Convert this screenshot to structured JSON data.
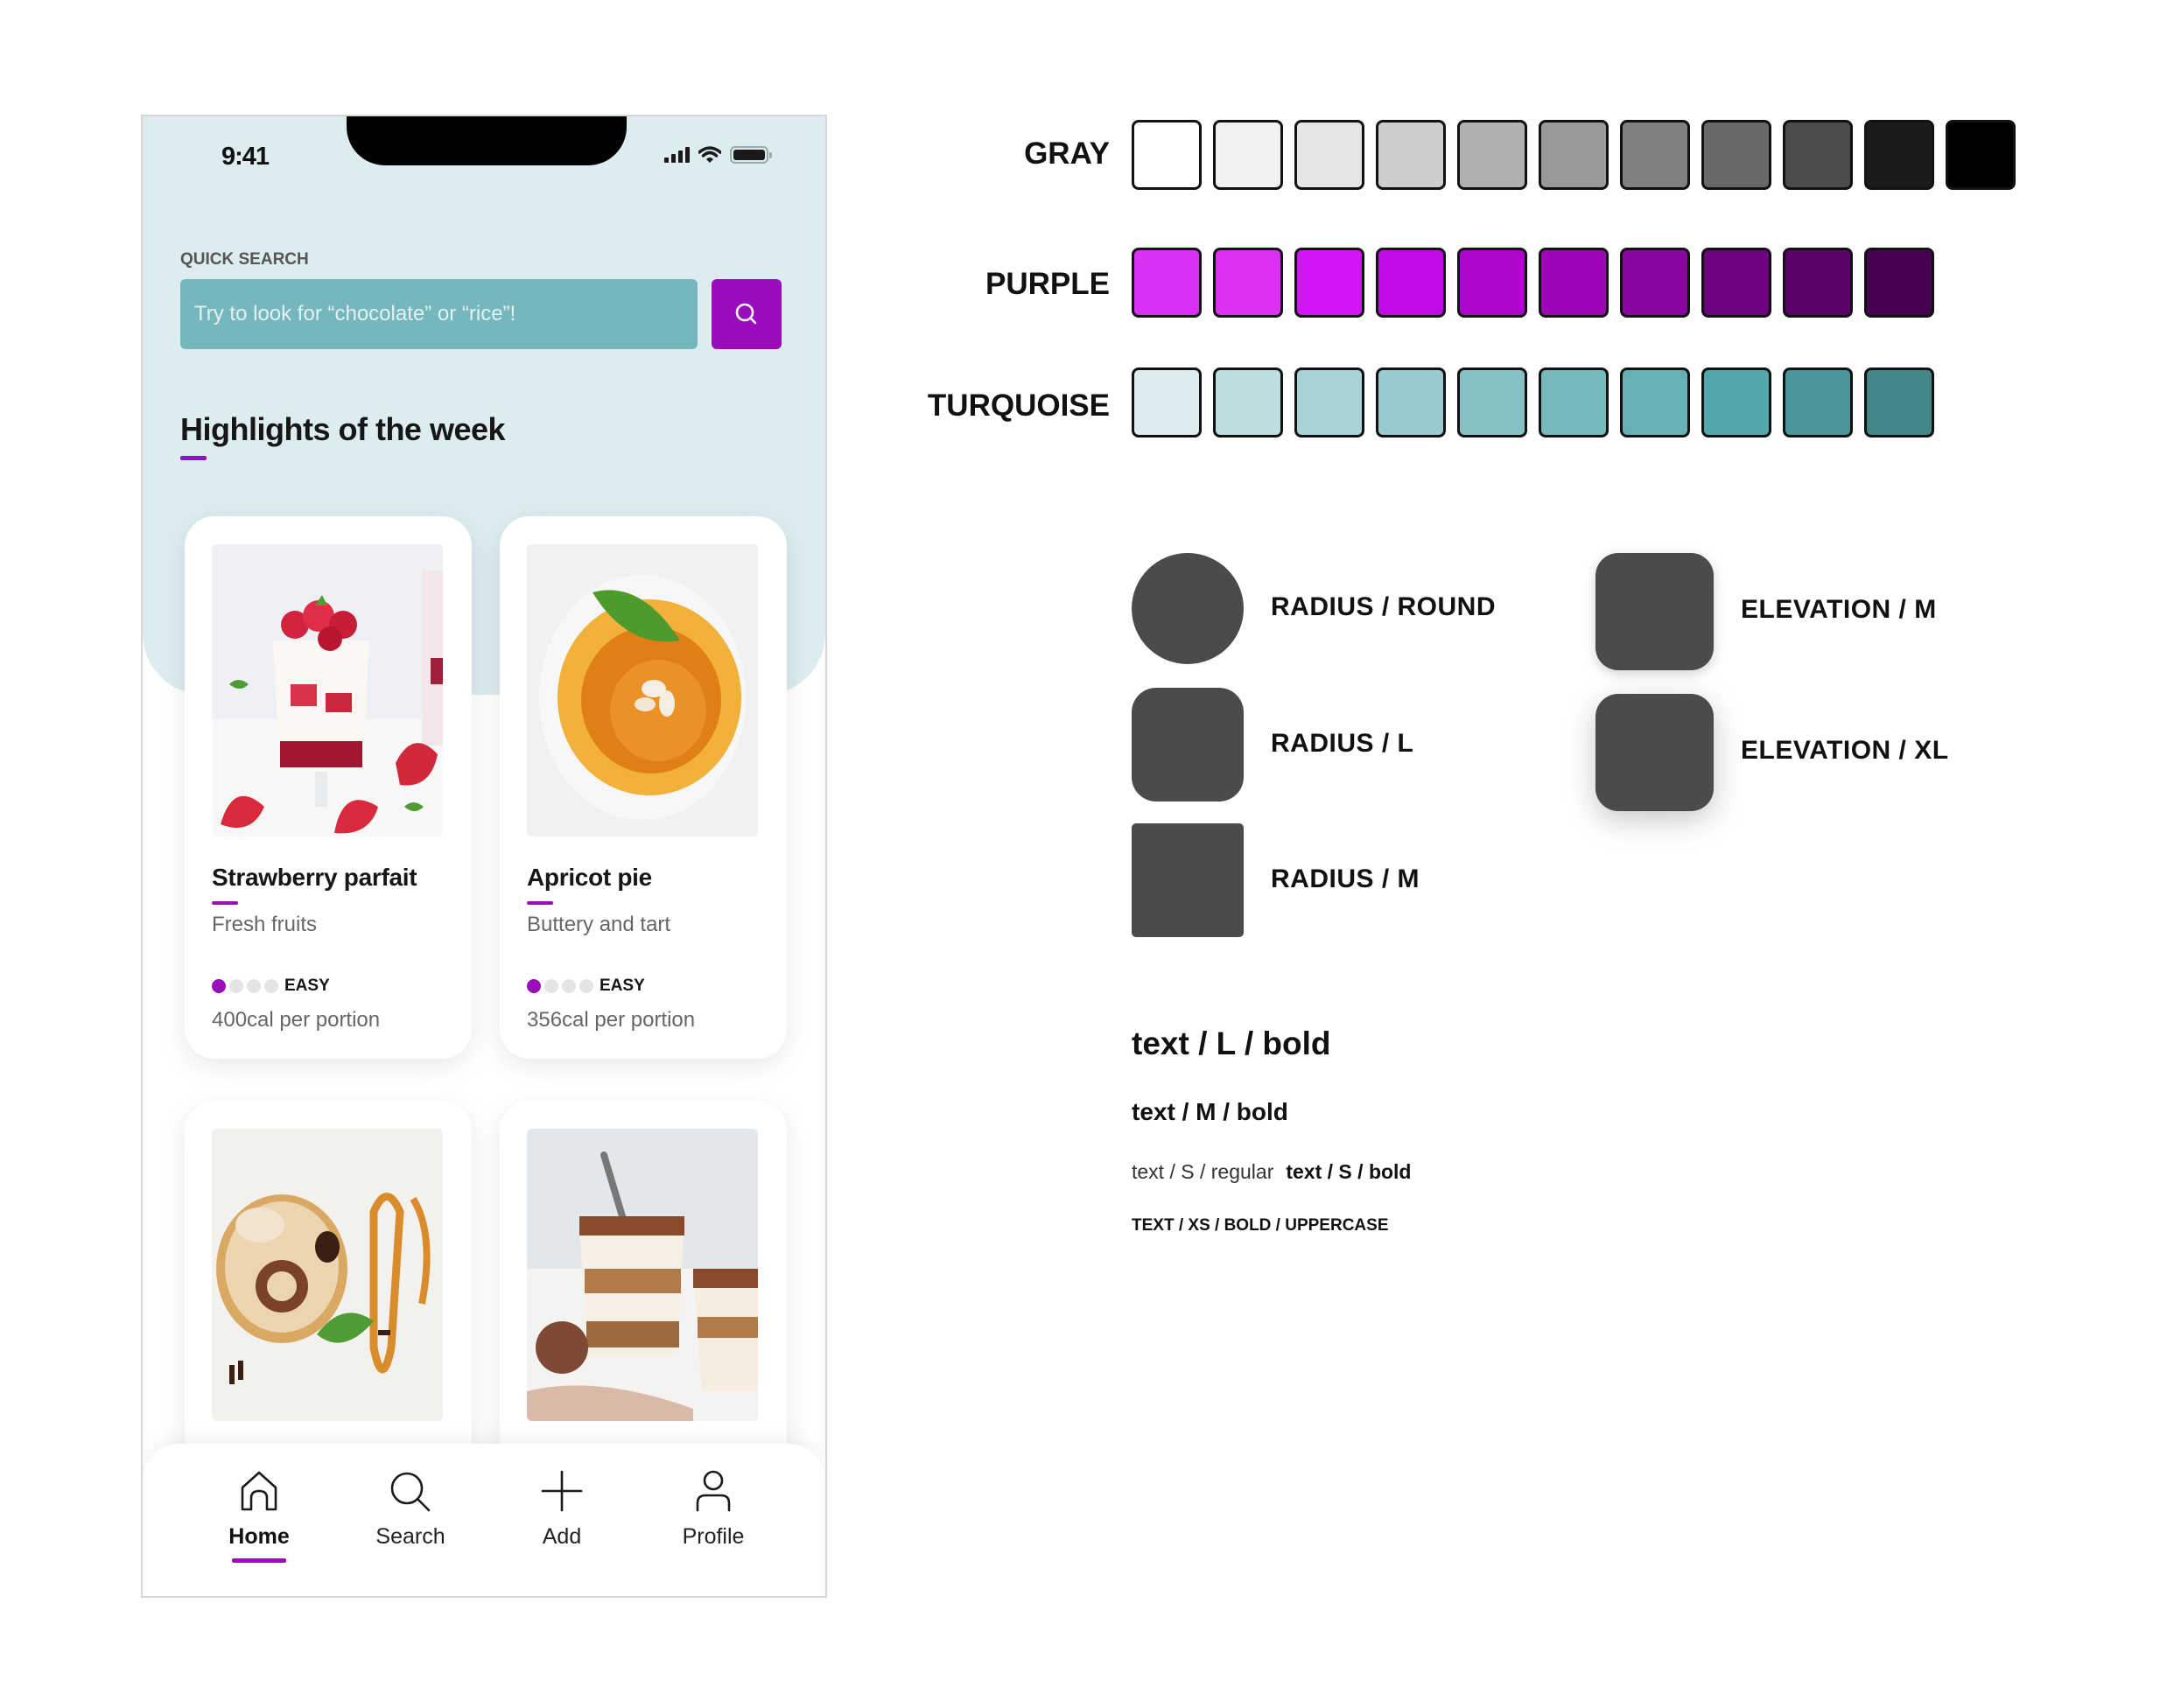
{
  "phone": {
    "status_bar": {
      "time": "9:41",
      "icons": [
        "cellular-signal-icon",
        "wifi-icon",
        "battery-icon"
      ]
    },
    "quick_search": {
      "label": "QUICK SEARCH",
      "placeholder": "Try to look for “chocolate” or “rice”!",
      "value": "",
      "button_icon": "search-icon"
    },
    "section_title": "Highlights of the week",
    "cards": [
      {
        "title": "Strawberry parfait",
        "subtitle": "Fresh fruits",
        "difficulty_label": "EASY",
        "difficulty_level": 1,
        "difficulty_max": 4,
        "calories": "400cal per portion",
        "image": "strawberry-parfait-photo"
      },
      {
        "title": "Apricot pie",
        "subtitle": "Buttery and tart",
        "difficulty_label": "EASY",
        "difficulty_level": 1,
        "difficulty_max": 4,
        "calories": "356cal per portion",
        "image": "apricot-pie-photo"
      },
      {
        "title": "",
        "subtitle": "",
        "image": "caramel-tart-photo"
      },
      {
        "title": "",
        "subtitle": "",
        "image": "tiramisu-photo"
      }
    ],
    "nav": [
      {
        "label": "Home",
        "icon": "home-icon",
        "active": true
      },
      {
        "label": "Search",
        "icon": "search-icon",
        "active": false
      },
      {
        "label": "Add",
        "icon": "plus-icon",
        "active": false
      },
      {
        "label": "Profile",
        "icon": "user-icon",
        "active": false
      }
    ],
    "colors": {
      "accent": "#9b0cba",
      "header_bg": "#dcecef",
      "search_bg": "#76b7bd"
    }
  },
  "tokens": {
    "palettes": [
      {
        "name": "GRAY",
        "swatches": [
          "#ffffff",
          "#f1f1f1",
          "#e5e5e5",
          "#cccccc",
          "#b0b0b0",
          "#999999",
          "#808080",
          "#686868",
          "#4c4c4c",
          "#1b1b1b",
          "#000000"
        ]
      },
      {
        "name": "PURPLE",
        "swatches": [
          "#da2ff6",
          "#dc31f5",
          "#d314f5",
          "#c20ae4",
          "#ad07cb",
          "#9c06b6",
          "#8b05a2",
          "#6e0381",
          "#5b0368",
          "#46024f"
        ]
      },
      {
        "name": "TURQUOISE",
        "swatches": [
          "#dcecef",
          "#bcdee1",
          "#a8d3d6",
          "#98cacd",
          "#87c1c4",
          "#77b8bd",
          "#65b1b5",
          "#52a7ab",
          "#4a9699",
          "#428688"
        ]
      }
    ],
    "radius": [
      {
        "label": "RADIUS / ROUND"
      },
      {
        "label": "RADIUS / L"
      },
      {
        "label": "RADIUS / M"
      }
    ],
    "elevation": [
      {
        "label": "ELEVATION / M"
      },
      {
        "label": "ELEVATION / XL"
      }
    ],
    "typography": {
      "l_bold": "text / L / bold",
      "m_bold": "text / M / bold",
      "s_regular": "text / S / regular",
      "s_bold": "text / S / bold",
      "xs_bold_upper": "TEXT / XS / BOLD / UPPERCASE"
    }
  }
}
